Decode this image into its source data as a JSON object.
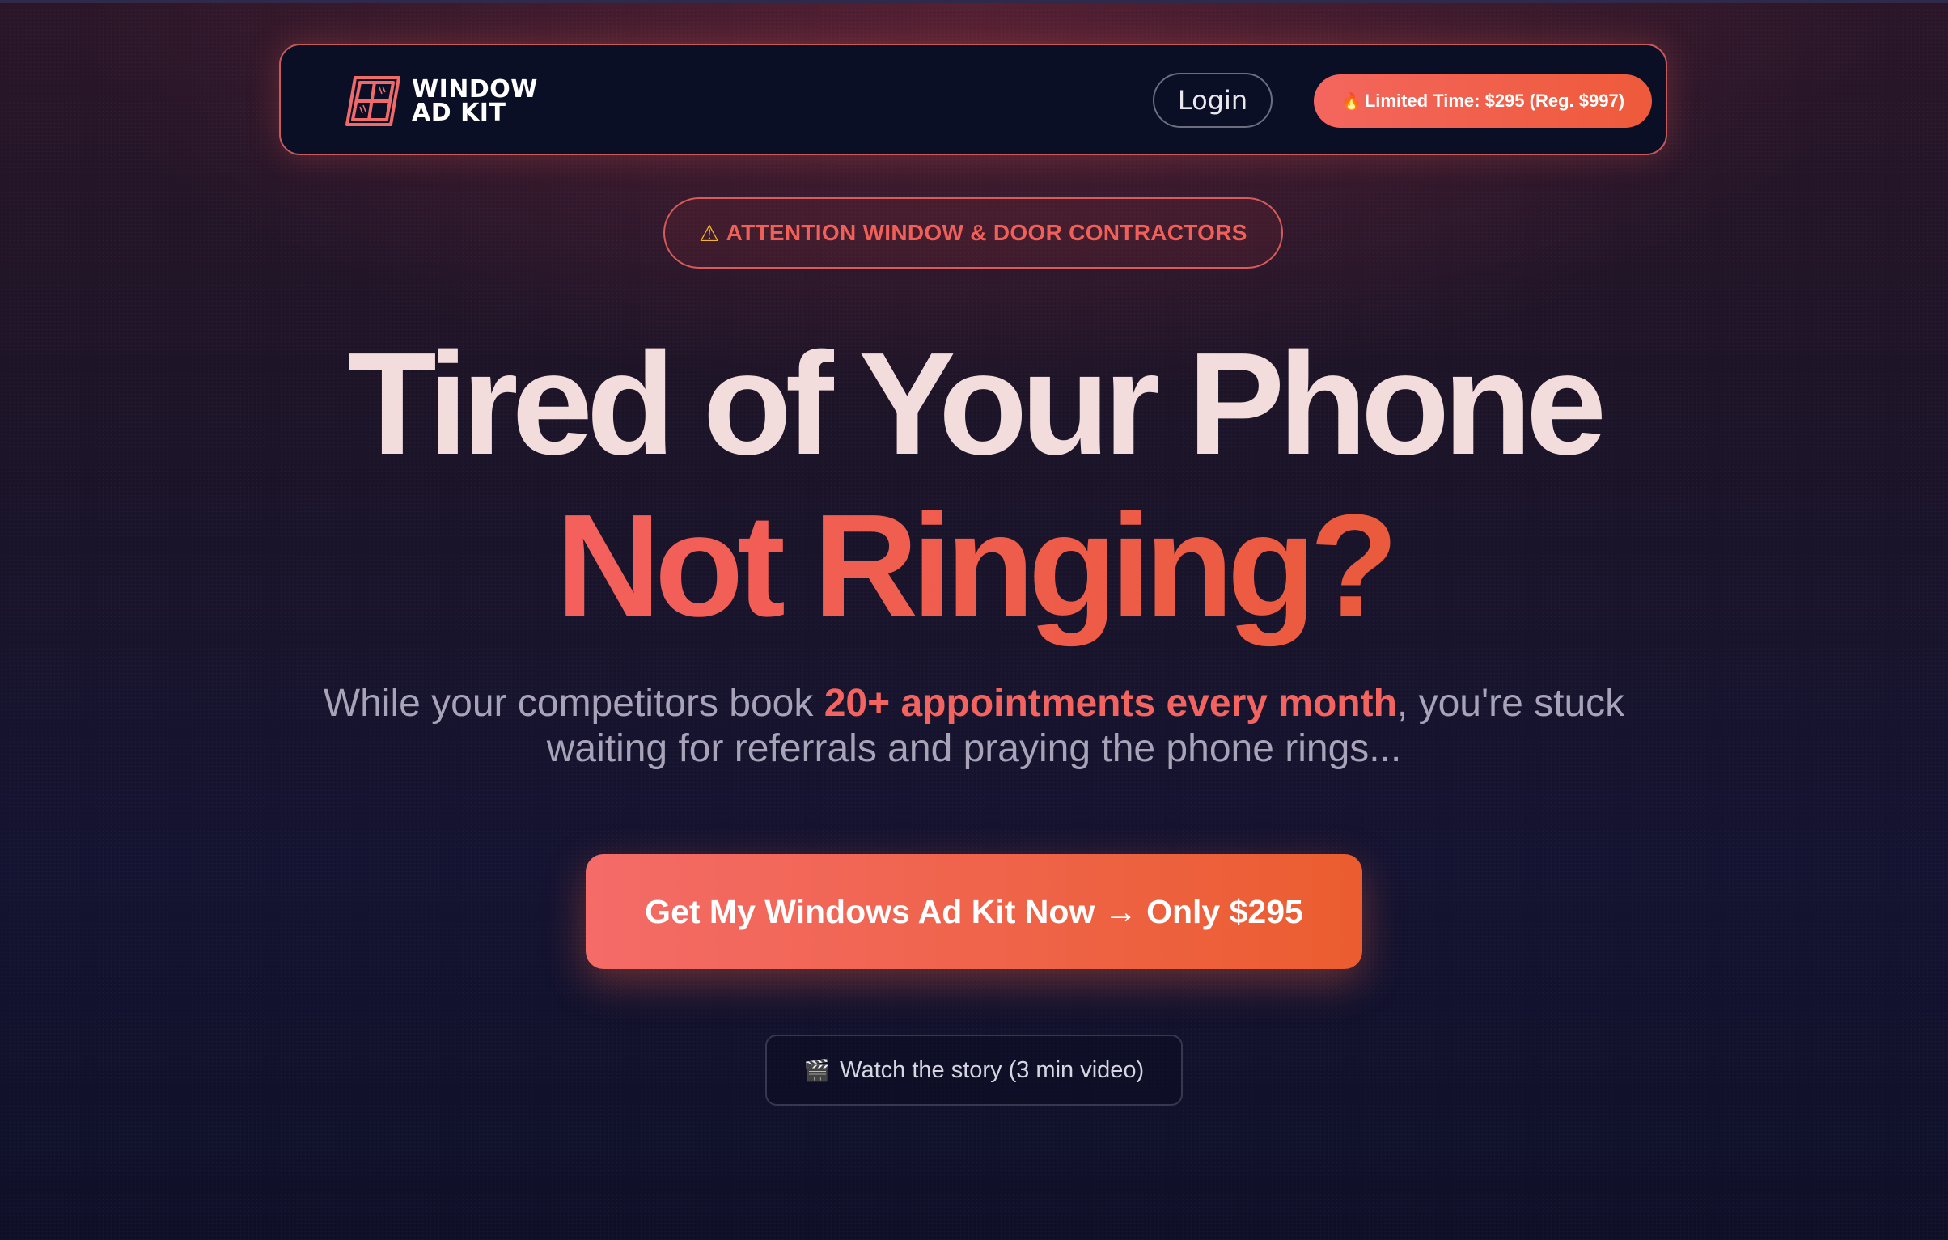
{
  "nav": {
    "logo_line1": "WINDOW",
    "logo_line2": "AD KIT",
    "login_label": "Login",
    "promo_icon": "🔥",
    "promo_label": "Limited Time: $295 (Reg. $997)"
  },
  "hero": {
    "badge_icon": "⚠",
    "badge_label": "ATTENTION WINDOW & DOOR CONTRACTORS",
    "headline_line1": "Tired of Your Phone",
    "headline_line2": "Not Ringing?",
    "sub_before": "While your competitors book ",
    "sub_highlight": "20+ appointments every month",
    "sub_after": ", you're stuck waiting for referrals and praying the phone rings...",
    "cta_label": "Get My Windows Ad Kit Now → Only $295",
    "video_icon": "🎬",
    "video_label": "Watch the story (3 min video)"
  },
  "colors": {
    "accent": "#F4605D",
    "accent_dark": "#EB5D2F",
    "nav_bg": "#0B0F26",
    "headline": "#F2DCDC",
    "subtext": "#A8A3B8"
  },
  "icons": {
    "logo": "window-frame-icon",
    "badge": "warning-icon",
    "promo": "fire-icon",
    "video": "clapperboard-icon"
  }
}
